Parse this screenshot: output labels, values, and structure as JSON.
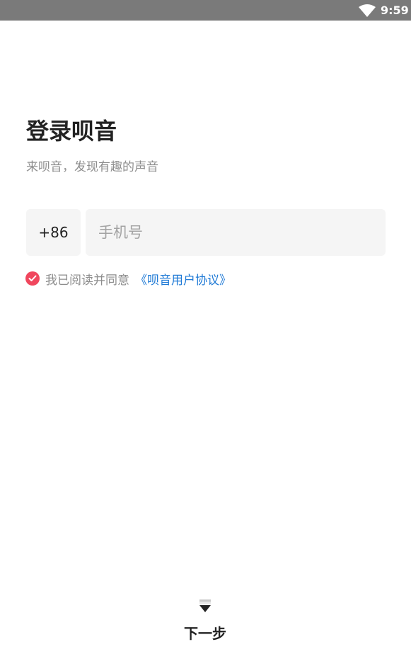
{
  "status_bar": {
    "time": "9:59",
    "wifi_icon": "wifi-icon",
    "background": "#7a7a7a"
  },
  "login": {
    "title": "登录呗音",
    "subtitle": "来呗音，发现有趣的声音",
    "country_code": "+86",
    "phone_placeholder": "手机号",
    "phone_value": "",
    "agreement": {
      "checked": true,
      "checkbox_icon": "check-circle-icon",
      "checkbox_color": "#f0465d",
      "text": "我已阅读并同意",
      "link_text": "《呗音用户协议》",
      "link_color": "#1f7ad6"
    },
    "next_icon": "down-arrow-icon",
    "next_label": "下一步"
  }
}
